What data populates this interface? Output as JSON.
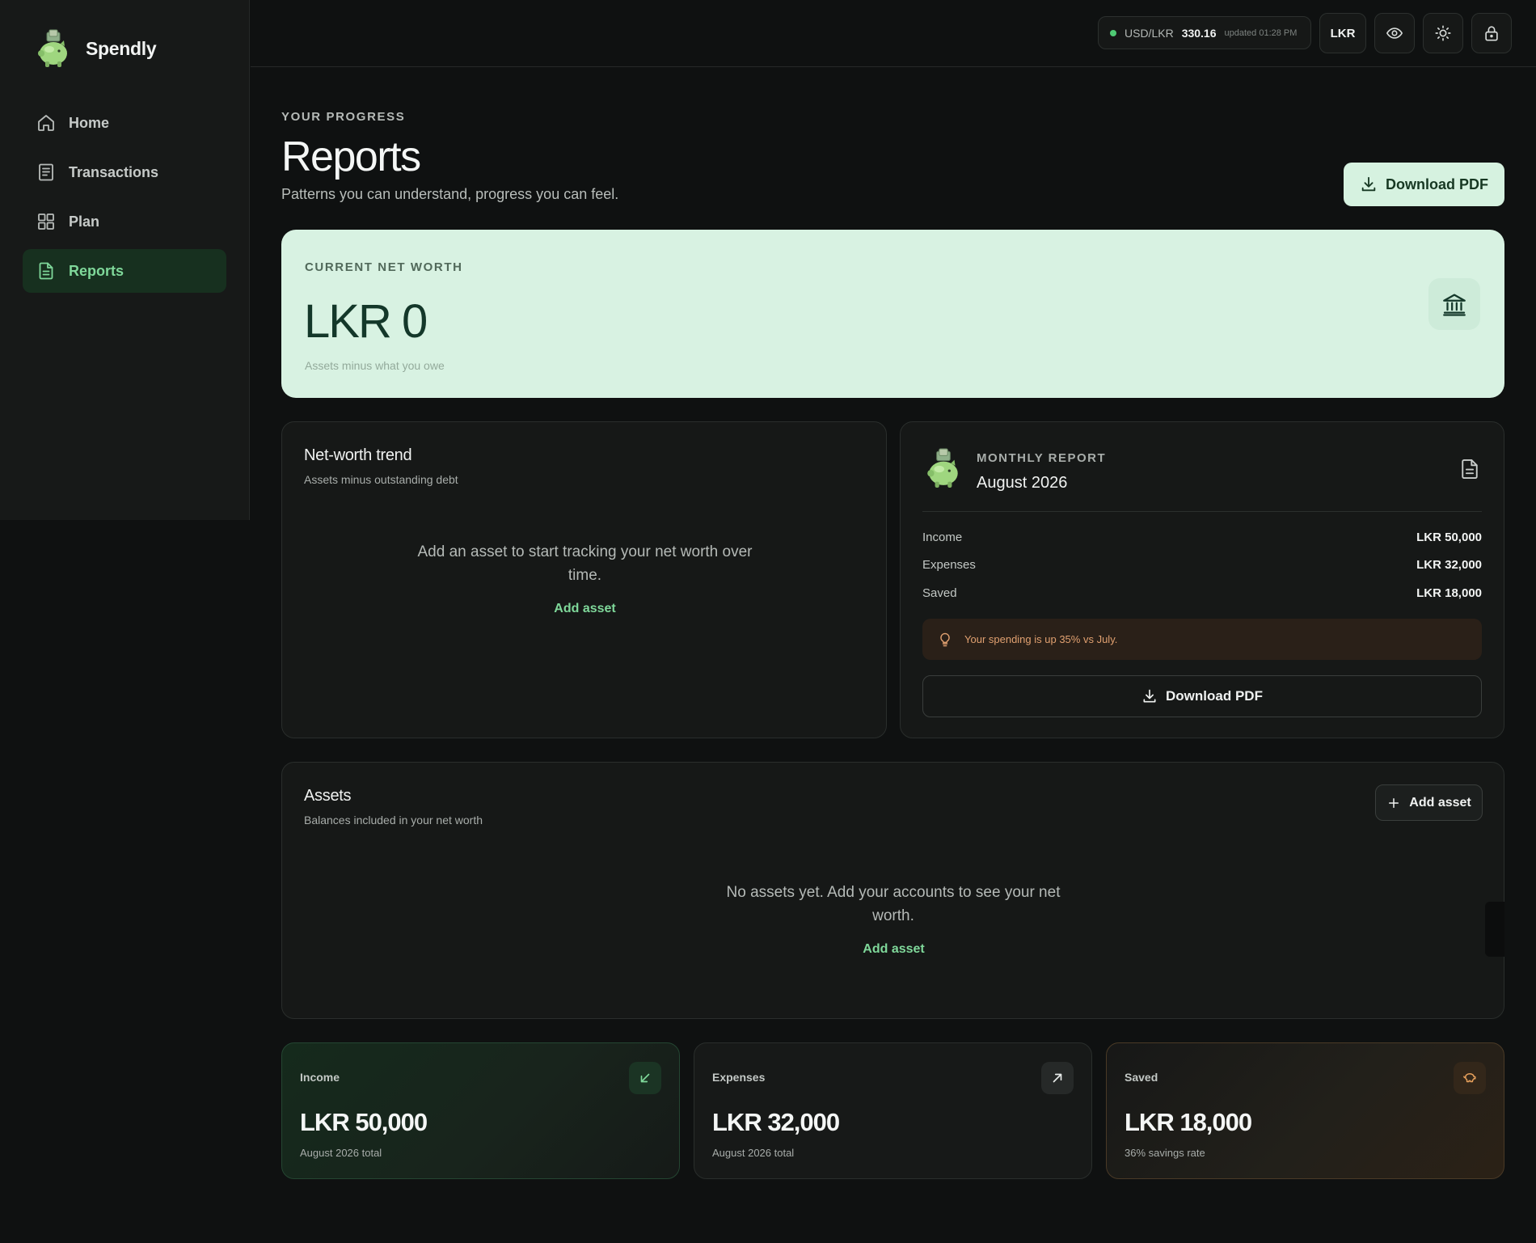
{
  "app": {
    "name": "Spendly",
    "logo_icon": "piggy-bank-icon"
  },
  "sidebar": {
    "items": [
      {
        "label": "Home",
        "icon": "home-icon",
        "active": false
      },
      {
        "label": "Transactions",
        "icon": "receipt-icon",
        "active": false
      },
      {
        "label": "Plan",
        "icon": "grid-icon",
        "active": false
      },
      {
        "label": "Reports",
        "icon": "document-icon",
        "active": true
      }
    ]
  },
  "topbar": {
    "rate": {
      "pair": "USD/LKR",
      "value": "330.16",
      "updated": "updated 01:28 PM",
      "status_color": "#4fca74"
    },
    "currency": "LKR",
    "buttons": [
      "eye-icon",
      "sun-icon",
      "lock-icon"
    ]
  },
  "header": {
    "eyebrow": "YOUR PROGRESS",
    "title": "Reports",
    "subtitle": "Patterns you can understand, progress you can feel.",
    "download_label": "Download PDF"
  },
  "net_worth": {
    "label": "CURRENT NET WORTH",
    "amount": "LKR 0",
    "hint": "Assets minus what you owe",
    "icon": "bank-icon"
  },
  "trend": {
    "title": "Net-worth trend",
    "subtitle": "Assets minus outstanding debt",
    "empty_message": "Add an asset to start tracking your net worth over time.",
    "empty_action": "Add asset"
  },
  "monthly_report": {
    "eyebrow": "MONTHLY REPORT",
    "month": "August 2026",
    "rows": [
      {
        "label": "Income",
        "value": "LKR 50,000"
      },
      {
        "label": "Expenses",
        "value": "LKR 32,000"
      },
      {
        "label": "Saved",
        "value": "LKR 18,000"
      }
    ],
    "insight": "Your spending is up 35% vs July.",
    "download_label": "Download PDF"
  },
  "assets": {
    "title": "Assets",
    "subtitle": "Balances included in your net worth",
    "add_button": "Add asset",
    "empty_message": "No assets yet. Add your accounts to see your net worth.",
    "empty_action": "Add asset"
  },
  "stats": [
    {
      "label": "Income",
      "amount": "LKR 50,000",
      "sub": "August 2026 total",
      "icon": "arrow-down-left-icon",
      "accent": "#7fd89a"
    },
    {
      "label": "Expenses",
      "amount": "LKR 32,000",
      "sub": "August 2026 total",
      "icon": "arrow-up-right-icon",
      "accent": "#e8ecea"
    },
    {
      "label": "Saved",
      "amount": "LKR 18,000",
      "sub": "36% savings rate",
      "icon": "piggy-bank-icon",
      "accent": "#e6a05c"
    }
  ],
  "colors": {
    "accent": "#7fd89a",
    "background": "#0f1111",
    "net_worth_card": "#d8f2e2"
  }
}
